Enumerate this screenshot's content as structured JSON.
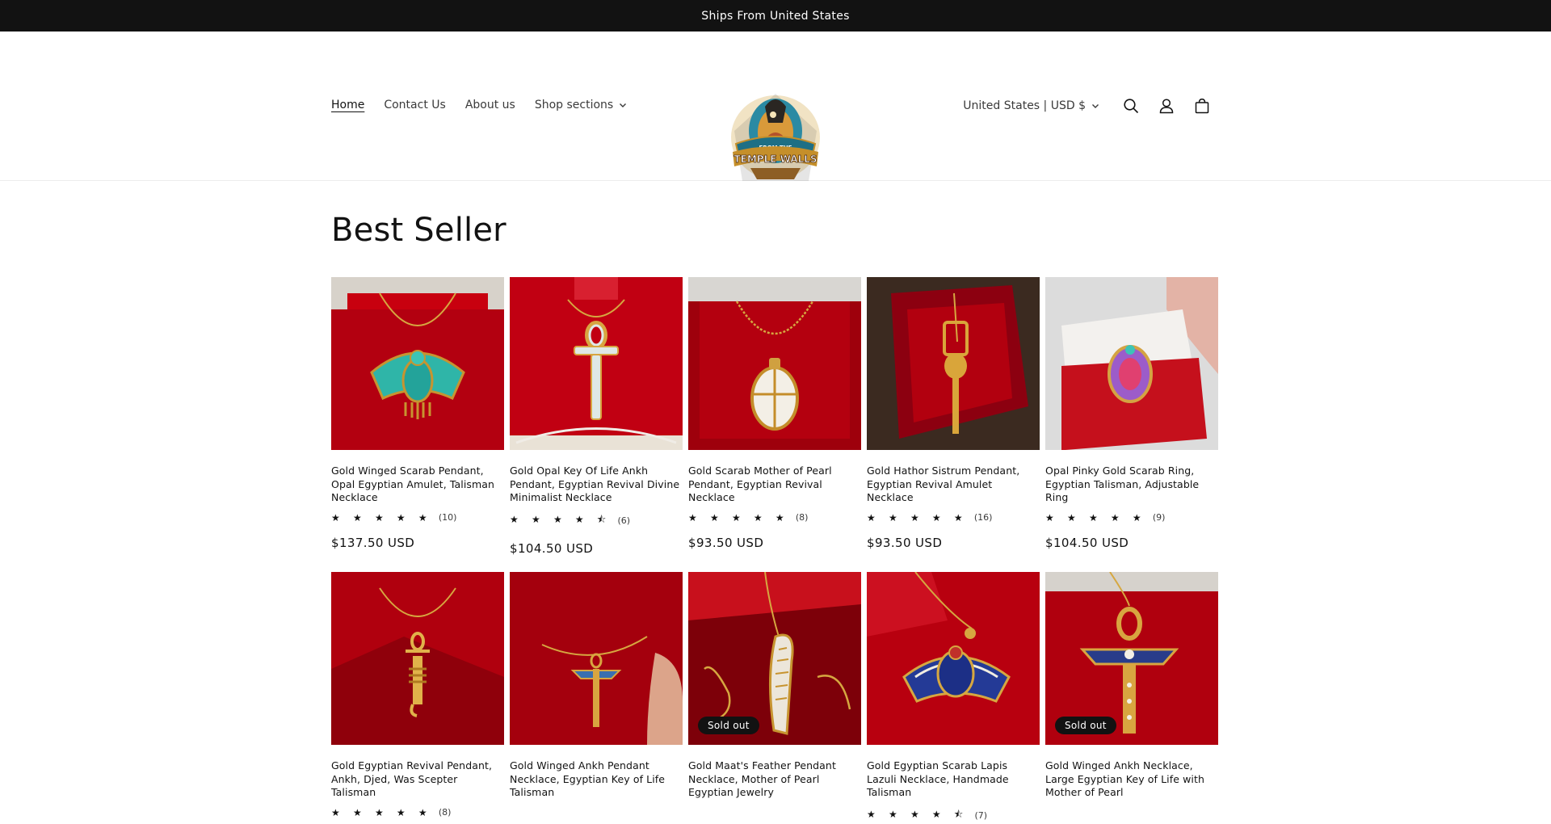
{
  "announcement": {
    "text": "Ships From United States"
  },
  "header": {
    "nav": [
      {
        "label": "Home",
        "active": true
      },
      {
        "label": "Contact Us",
        "active": false
      },
      {
        "label": "About us",
        "active": false
      },
      {
        "label": "Shop sections",
        "active": false,
        "has_dropdown": true
      }
    ],
    "logo": {
      "line1": "FROM THE",
      "line2": "TEMPLE WALLS"
    },
    "country_selector": "United States | USD $",
    "icons": [
      "search-icon",
      "account-icon",
      "cart-icon"
    ]
  },
  "section": {
    "title": "Best Seller"
  },
  "products": [
    {
      "name": "Gold Winged Scarab Pendant, Opal Egyptian Amulet, Talisman Necklace",
      "stars": "★ ★ ★ ★ ★",
      "rating_value": 5,
      "reviews": "(10)",
      "price": "$137.50 USD",
      "sold_out": false,
      "item": "winged-scarab-pendant",
      "colors": [
        "#b30010",
        "#2fb5a8"
      ]
    },
    {
      "name": "Gold Opal Key Of Life Ankh Pendant, Egyptian Revival Divine Minimalist Necklace",
      "stars": "★ ★ ★ ★ ⯪",
      "rating_value": 4.5,
      "reviews": "(6)",
      "price": "$104.50 USD",
      "sold_out": false,
      "item": "ankh-pendant",
      "colors": [
        "#c10012",
        "#dfe8e6"
      ]
    },
    {
      "name": "Gold Scarab Mother of Pearl Pendant, Egyptian Revival Necklace",
      "stars": "★ ★ ★ ★ ★",
      "rating_value": 5,
      "reviews": "(8)",
      "price": "$93.50 USD",
      "sold_out": false,
      "item": "pearl-scarab-pendant",
      "colors": [
        "#9e000c",
        "#f3efe6"
      ]
    },
    {
      "name": "Gold Hathor Sistrum Pendant, Egyptian Revival Amulet Necklace",
      "stars": "★ ★ ★ ★ ★",
      "rating_value": 5,
      "reviews": "(16)",
      "price": "$93.50 USD",
      "sold_out": false,
      "item": "sistrum-pendant",
      "colors": [
        "#6a0008",
        "#d9a53a"
      ]
    },
    {
      "name": "Opal Pinky Gold Scarab Ring, Egyptian Talisman, Adjustable Ring",
      "stars": "★ ★ ★ ★ ★",
      "rating_value": 5,
      "reviews": "(9)",
      "price": "$104.50 USD",
      "sold_out": false,
      "item": "scarab-ring",
      "colors": [
        "#c5101c",
        "#9c5cc9"
      ]
    },
    {
      "name": "Gold Egyptian Revival Pendant, Ankh, Djed, Was Scepter Talisman",
      "stars": "★ ★ ★ ★ ★",
      "rating_value": 5,
      "reviews": "(8)",
      "price": "",
      "sold_out": false,
      "item": "djed-pendant",
      "colors": [
        "#b0000e",
        "#e1b24a"
      ]
    },
    {
      "name": "Gold Winged Ankh Pendant Necklace, Egyptian Key of Life Talisman",
      "stars": "",
      "rating_value": null,
      "reviews": "",
      "price": "",
      "sold_out": false,
      "item": "winged-ankh-pendant",
      "colors": [
        "#a4000d",
        "#3a6fb0"
      ]
    },
    {
      "name": "Gold Maat's Feather Pendant Necklace, Mother of Pearl Egyptian Jewelry",
      "stars": "",
      "rating_value": null,
      "reviews": "",
      "price": "",
      "sold_out": true,
      "sold_out_label": "Sold out",
      "item": "feather-pendant",
      "colors": [
        "#7d0009",
        "#ece6da"
      ]
    },
    {
      "name": "Gold Egyptian Scarab Lapis Lazuli Necklace, Handmade Talisman",
      "stars": "★ ★ ★ ★ ⯪",
      "rating_value": 4.5,
      "reviews": "(7)",
      "price": "",
      "sold_out": false,
      "item": "lapis-scarab-necklace",
      "colors": [
        "#b8000f",
        "#243a96"
      ]
    },
    {
      "name": "Gold Winged Ankh Necklace, Large Egyptian Key of Life with Mother of Pearl",
      "stars": "",
      "rating_value": null,
      "reviews": "",
      "price": "",
      "sold_out": true,
      "sold_out_label": "Sold out",
      "item": "large-winged-ankh",
      "colors": [
        "#b0000e",
        "#283c8a"
      ]
    }
  ]
}
